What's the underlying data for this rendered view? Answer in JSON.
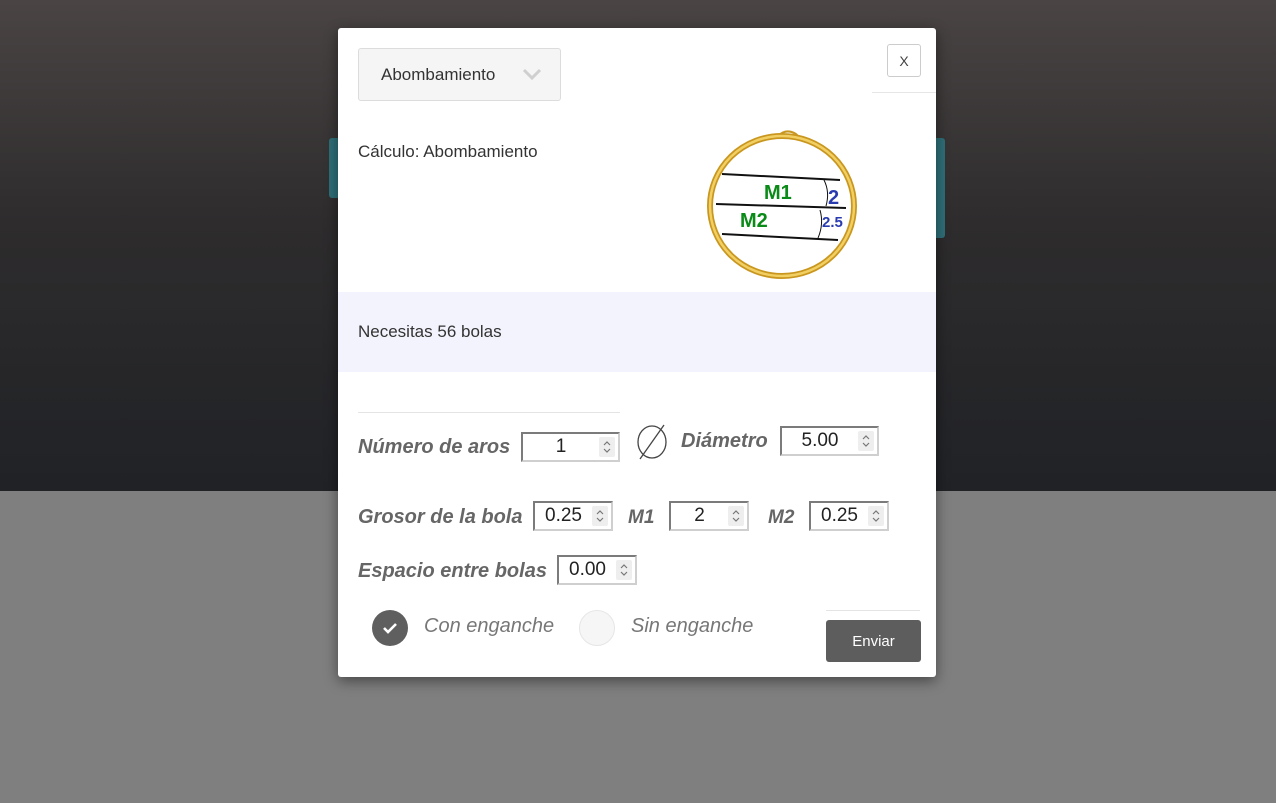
{
  "dropdown": {
    "selected": "Abombamiento"
  },
  "close_label": "X",
  "calc_title": "Cálculo: Abombamiento",
  "diagram": {
    "m1": "M1",
    "m2": "M2",
    "v1": "2",
    "v2": "2.5"
  },
  "result": "Necesitas 56 bolas",
  "fields": {
    "numero_aros": {
      "label": "Número de aros",
      "value": "1"
    },
    "diametro": {
      "label": "Diámetro",
      "value": "5.00"
    },
    "grosor": {
      "label": "Grosor de la bola",
      "value": "0.25"
    },
    "m1": {
      "label": "M1",
      "value": "2"
    },
    "m2": {
      "label": "M2",
      "value": "0.25"
    },
    "espacio": {
      "label": "Espacio entre bolas",
      "value": "0.00"
    }
  },
  "radios": {
    "con": "Con enganche",
    "sin": "Sin enganche",
    "selected": "con"
  },
  "submit_label": "Enviar",
  "colors": {
    "m_label": "#0a8a16",
    "value_label": "#2a3bb0",
    "gold": "#d9a935"
  }
}
